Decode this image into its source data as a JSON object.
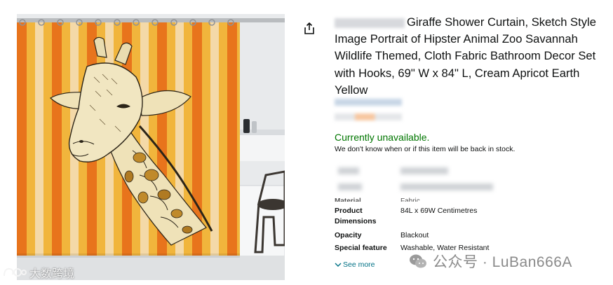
{
  "product": {
    "title": "Giraffe Shower Curtain, Sketch Style Image Portrait of Hipster Animal Zoo Savannah Wildlife Themed, Cloth Fabric Bathroom Decor Set with Hooks, 69\" W x 84\" L, Cream Apricot Earth Yellow",
    "availability": "Currently unavailable.",
    "stock_note": "We don't know when or if this item will be back in stock."
  },
  "specs": {
    "partial_label": "Material",
    "partial_value": "Fabric",
    "rows": [
      {
        "label": "Product Dimensions",
        "value": "84L x 69W Centimetres"
      },
      {
        "label": "Opacity",
        "value": "Blackout"
      },
      {
        "label": "Special feature",
        "value": "Washable, Water Resistant"
      }
    ],
    "see_more": "See more"
  },
  "watermarks": {
    "right": "公众号 · LuBan666A",
    "left": "大数跨境"
  },
  "icons": {
    "share": "share-icon",
    "chevron": "chevron-down-icon",
    "wechat": "wechat-icon"
  },
  "colors": {
    "availability": "#007600",
    "link": "#007185",
    "stripe_orange": "#e8741c",
    "stripe_yellow": "#f1b53c",
    "stripe_cream": "#f4d9a8"
  }
}
